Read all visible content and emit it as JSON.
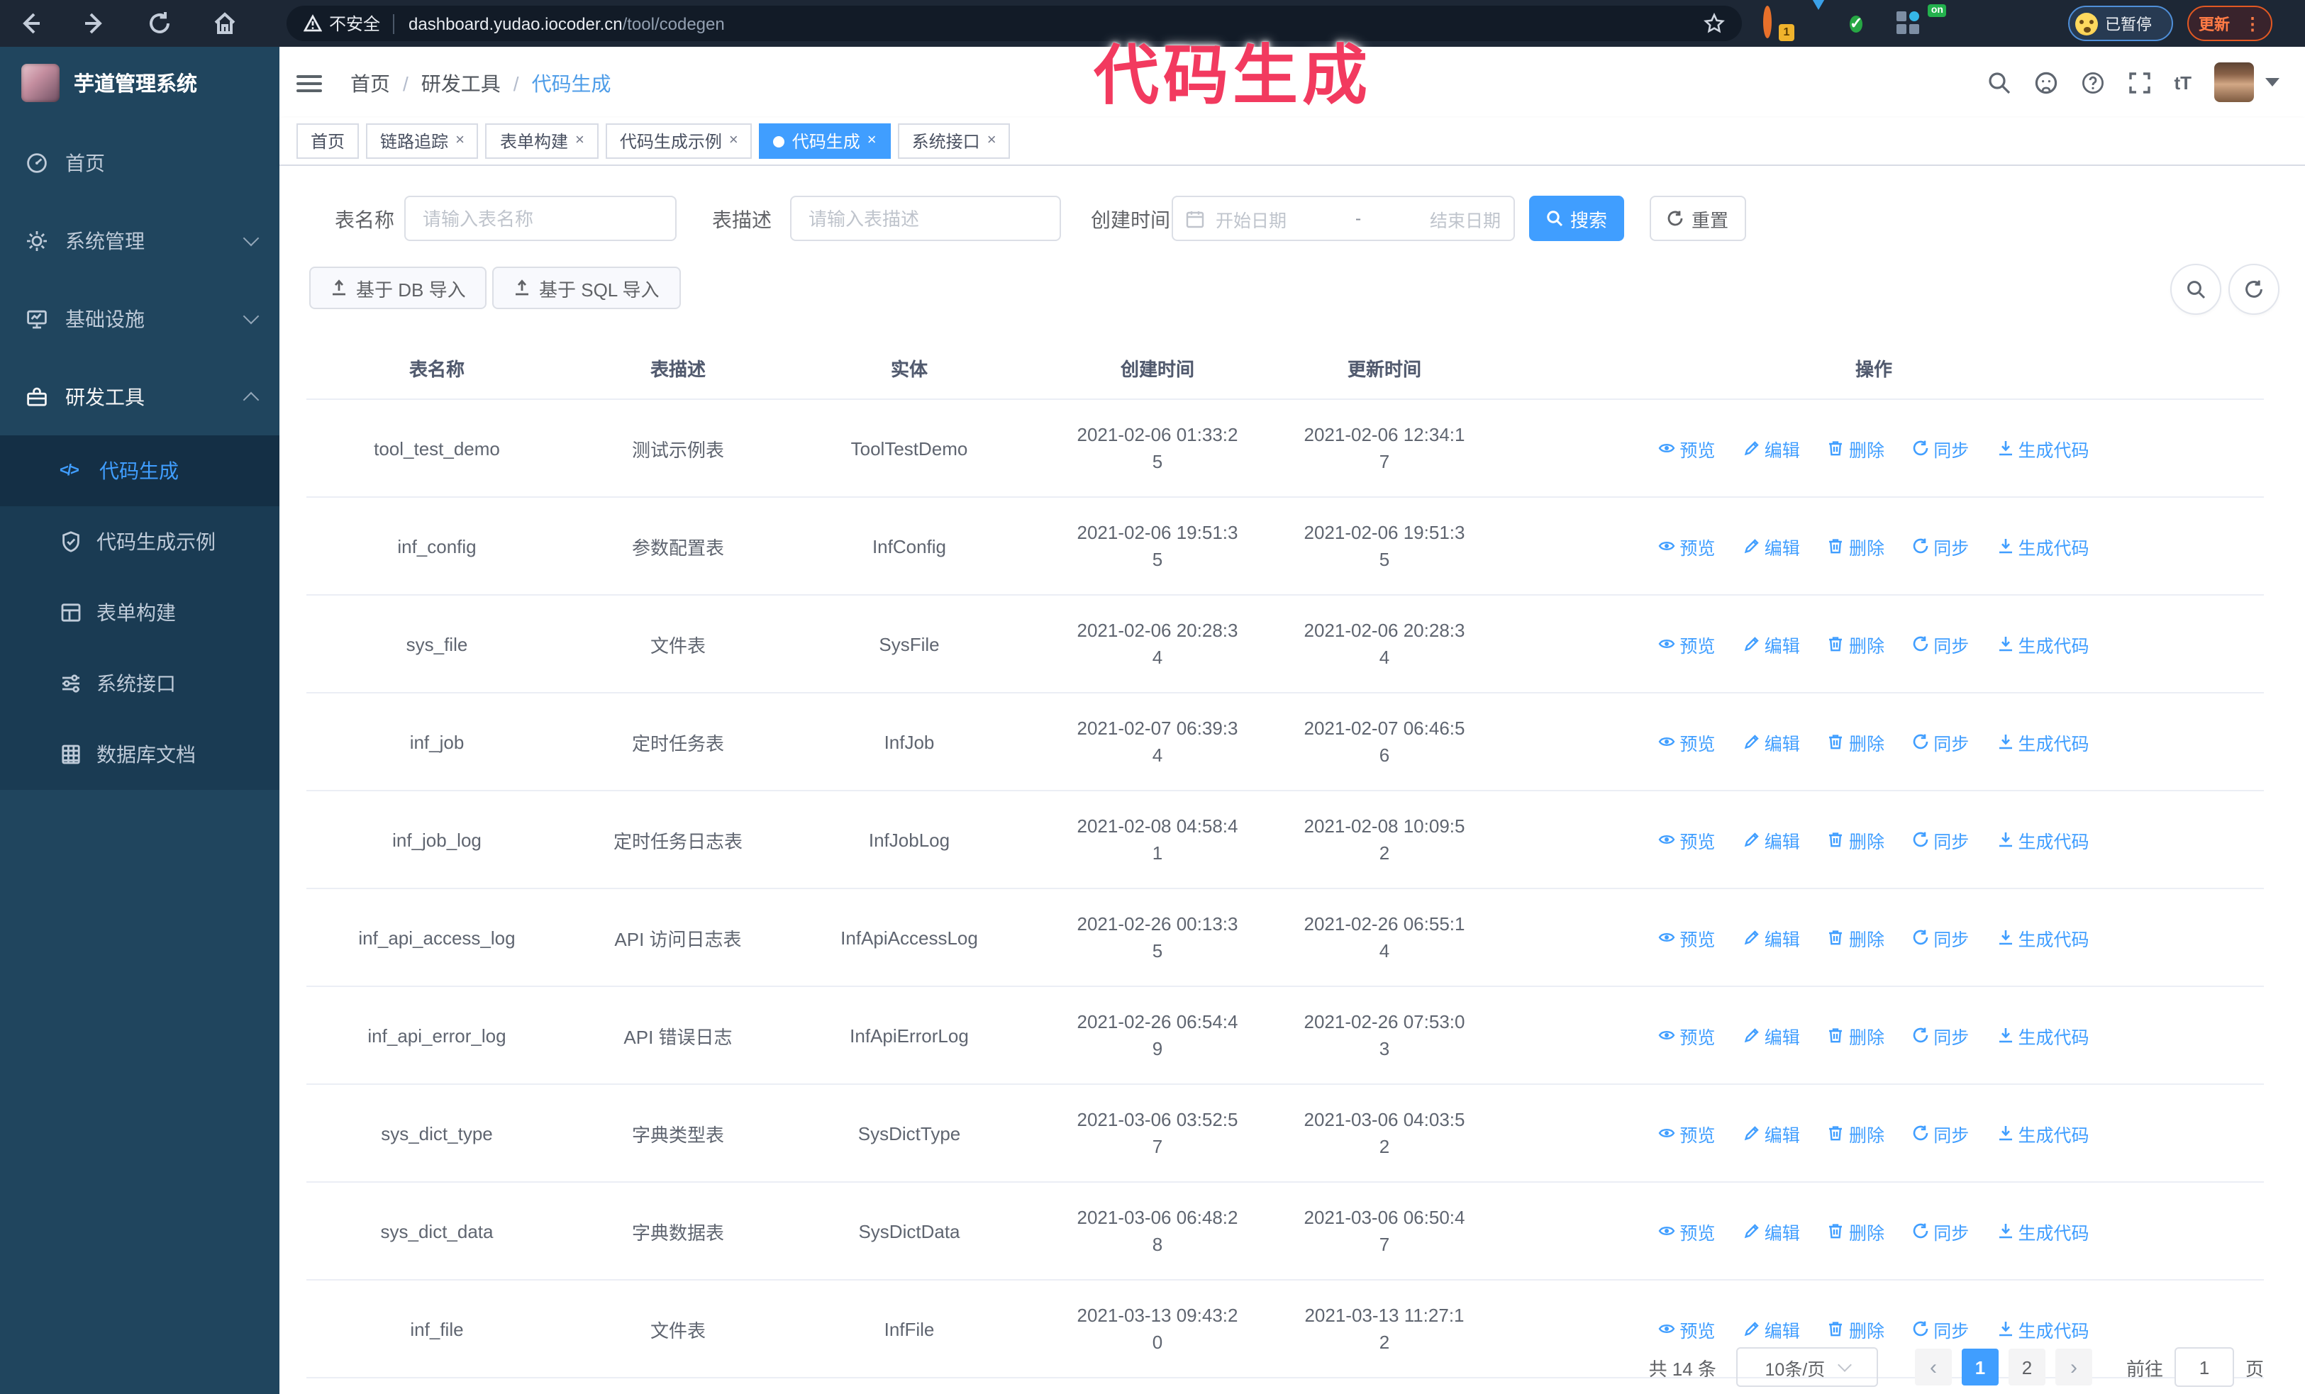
{
  "browser": {
    "security_label": "不安全",
    "url_host": "dashboard.yudao.iocoder.cn",
    "url_path": "/tool/codegen",
    "ext_badge": "1",
    "ext_on_badge": "on",
    "ext_check": "✓",
    "paused_badge": "已暂停",
    "update_label": "更新",
    "update_dots": "⋮"
  },
  "overlay": {
    "text": "代码生成",
    "color": "#F23A5F"
  },
  "sidebar": {
    "title": "芋道管理系统",
    "items": [
      {
        "label": "首页"
      },
      {
        "label": "系统管理"
      },
      {
        "label": "基础设施"
      },
      {
        "label": "研发工具"
      }
    ],
    "subitems": [
      {
        "label": "代码生成"
      },
      {
        "label": "代码生成示例"
      },
      {
        "label": "表单构建"
      },
      {
        "label": "系统接口"
      },
      {
        "label": "数据库文档"
      }
    ],
    "code_icon_text": "</>"
  },
  "header": {
    "breadcrumb": [
      "首页",
      "研发工具",
      "代码生成"
    ],
    "separator": "/",
    "font_icon_text": "tT"
  },
  "tabs": [
    {
      "label": "首页"
    },
    {
      "label": "链路追踪",
      "close": "×"
    },
    {
      "label": "表单构建",
      "close": "×"
    },
    {
      "label": "代码生成示例",
      "close": "×"
    },
    {
      "label": "代码生成",
      "close": "×"
    },
    {
      "label": "系统接口",
      "close": "×"
    }
  ],
  "filters": {
    "name_label": "表名称",
    "name_placeholder": "请输入表名称",
    "desc_label": "表描述",
    "desc_placeholder": "请输入表描述",
    "time_label": "创建时间",
    "start_placeholder": "开始日期",
    "range_separator": "-",
    "end_placeholder": "结束日期",
    "search_label": "搜索",
    "reset_label": "重置"
  },
  "toolbar": {
    "import_db_label": "基于 DB 导入",
    "import_sql_label": "基于 SQL 导入"
  },
  "table": {
    "columns": [
      "表名称",
      "表描述",
      "实体",
      "创建时间",
      "更新时间",
      "操作"
    ],
    "action_labels": [
      "预览",
      "编辑",
      "删除",
      "同步",
      "生成代码"
    ],
    "rows": [
      {
        "name": "tool_test_demo",
        "description": "测试示例表",
        "entity": "ToolTestDemo",
        "created": "2021-02-06 01:33:25",
        "updated": "2021-02-06 12:34:17"
      },
      {
        "name": "inf_config",
        "description": "参数配置表",
        "entity": "InfConfig",
        "created": "2021-02-06 19:51:35",
        "updated": "2021-02-06 19:51:35"
      },
      {
        "name": "sys_file",
        "description": "文件表",
        "entity": "SysFile",
        "created": "2021-02-06 20:28:34",
        "updated": "2021-02-06 20:28:34"
      },
      {
        "name": "inf_job",
        "description": "定时任务表",
        "entity": "InfJob",
        "created": "2021-02-07 06:39:34",
        "updated": "2021-02-07 06:46:56"
      },
      {
        "name": "inf_job_log",
        "description": "定时任务日志表",
        "entity": "InfJobLog",
        "created": "2021-02-08 04:58:41",
        "updated": "2021-02-08 10:09:52"
      },
      {
        "name": "inf_api_access_log",
        "description": "API 访问日志表",
        "entity": "InfApiAccessLog",
        "created": "2021-02-26 00:13:35",
        "updated": "2021-02-26 06:55:14"
      },
      {
        "name": "inf_api_error_log",
        "description": "API 错误日志",
        "entity": "InfApiErrorLog",
        "created": "2021-02-26 06:54:49",
        "updated": "2021-02-26 07:53:03"
      },
      {
        "name": "sys_dict_type",
        "description": "字典类型表",
        "entity": "SysDictType",
        "created": "2021-03-06 03:52:57",
        "updated": "2021-03-06 04:03:52"
      },
      {
        "name": "sys_dict_data",
        "description": "字典数据表",
        "entity": "SysDictData",
        "created": "2021-03-06 06:48:28",
        "updated": "2021-03-06 06:50:47"
      },
      {
        "name": "inf_file",
        "description": "文件表",
        "entity": "InfFile",
        "created": "2021-03-13 09:43:20",
        "updated": "2021-03-13 11:27:12"
      }
    ]
  },
  "pagination": {
    "total": "共 14 条",
    "page_size": "10条/页",
    "prev": "‹",
    "page1": "1",
    "page2": "2",
    "next": "›",
    "goto_label": "前往",
    "goto_value": "1",
    "unit_label": "页"
  },
  "colors": {
    "accent": "#409EFF",
    "sidebar_bg": "#20455E",
    "submenu_bg": "#1A3B53",
    "browser_bar": "#1D2735",
    "overlay_pink": "#F23A5F"
  }
}
